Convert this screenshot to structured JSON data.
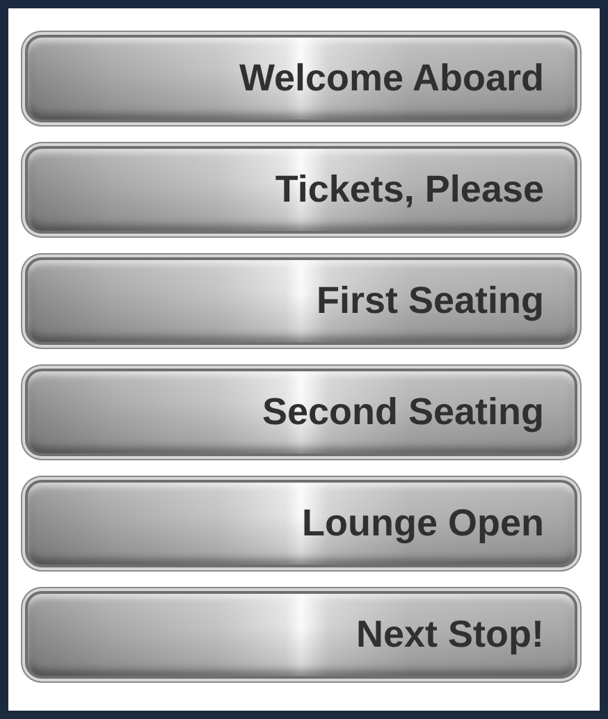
{
  "buttons": [
    {
      "label": "Welcome Aboard"
    },
    {
      "label": "Tickets, Please"
    },
    {
      "label": "First Seating"
    },
    {
      "label": "Second Seating"
    },
    {
      "label": "Lounge Open"
    },
    {
      "label": "Next Stop!"
    }
  ]
}
